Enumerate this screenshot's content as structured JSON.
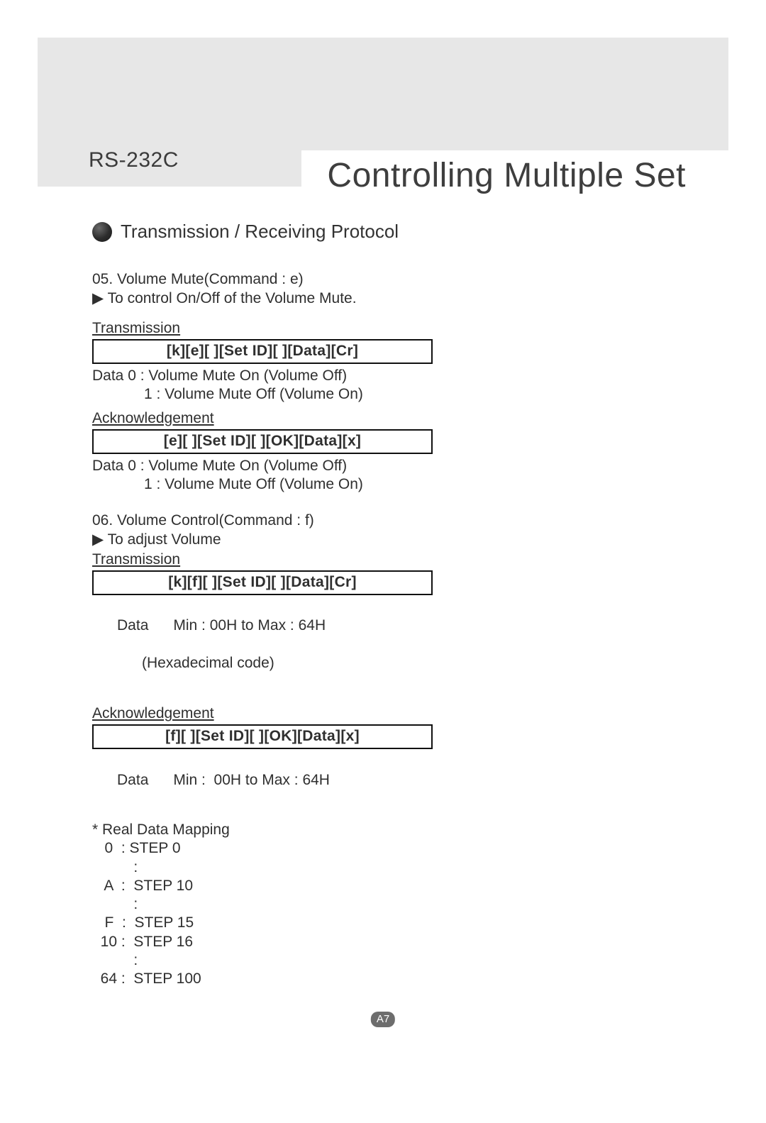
{
  "header": {
    "label": "RS-232C",
    "title": "Controlling Multiple Set"
  },
  "section_title": "Transmission / Receiving Protocol",
  "cmd05": {
    "title": "05. Volume  Mute(Command : e)",
    "desc": "▶ To control On/Off of the Volume Mute.",
    "tx_label": "Transmission",
    "tx_code": "[k][e][ ][Set ID][ ][Data][Cr]",
    "tx_data_l1": "Data 0 : Volume Mute On (Volume Off)",
    "tx_data_l2": "1 : Volume Mute Off (Volume On)",
    "ack_label": "Acknowledgement",
    "ack_code": "[e][ ][Set ID][ ][OK][Data][x]",
    "ack_data_l1": "Data 0 : Volume Mute On (Volume Off)",
    "ack_data_l2": "1 : Volume Mute Off (Volume On)"
  },
  "cmd06": {
    "title": "06. Volume  Control(Command : f)",
    "desc": "▶ To adjust Volume",
    "tx_label": "Transmission",
    "tx_code": "[k][f][ ][Set ID][ ][Data][Cr]",
    "tx_data_l1": "Data      Min : 00H to Max : 64H",
    "tx_data_l2": "      (Hexadecimal code)",
    "ack_label": "Acknowledgement",
    "ack_code": "[f][ ][Set ID][ ][OK][Data][x]",
    "ack_data_l1": "Data      Min :  00H to Max : 64H"
  },
  "mapping": {
    "title": "* Real Data Mapping",
    "rows": [
      "   0  : STEP 0",
      "          :",
      "   A  :  STEP 10",
      "          :",
      "   F  :  STEP 15",
      "  10 :  STEP 16",
      "          :",
      "  64 :  STEP 100"
    ]
  },
  "page_number": "A7"
}
